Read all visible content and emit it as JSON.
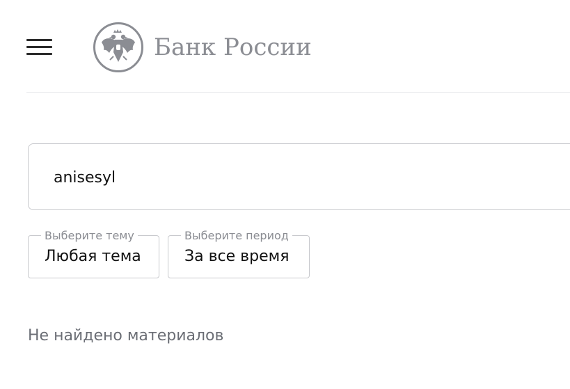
{
  "header": {
    "menu_icon": "hamburger-menu-icon",
    "logo_icon": "double-headed-eagle-emblem",
    "logo_text": "Банк России"
  },
  "search": {
    "value": "anisesyl"
  },
  "filters": {
    "theme": {
      "legend": "Выберите тему",
      "value": "Любая тема"
    },
    "period": {
      "legend": "Выберите период",
      "value": "За все время"
    }
  },
  "results": {
    "empty_message": "Не найдено материалов"
  },
  "colors": {
    "logo_gray": "#8b8d93",
    "border": "#c8c9cd",
    "muted_text": "#6b6e75"
  }
}
